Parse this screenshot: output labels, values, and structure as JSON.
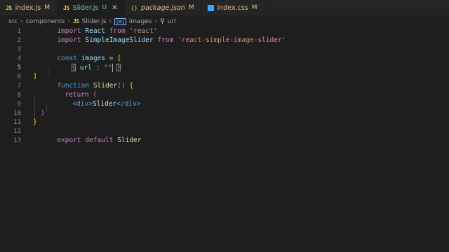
{
  "tabs": [
    {
      "name": "index.js",
      "badge": "M",
      "icon": "js-icon",
      "active": false
    },
    {
      "name": "Slider.js",
      "badge": "U",
      "icon": "js-icon",
      "active": true
    },
    {
      "name": "package.json",
      "badge": "M",
      "icon": "json-icon",
      "active": false
    },
    {
      "name": "index.css",
      "badge": "M",
      "icon": "css-icon",
      "active": false
    }
  ],
  "icons": {
    "js": "JS",
    "json": "{}",
    "close": "✕"
  },
  "breadcrumb": {
    "items": [
      "src",
      "components",
      "Slider.js",
      "images",
      "url"
    ],
    "array_symbol": "[ø]"
  },
  "editor": {
    "line_numbers": [
      "1",
      "2",
      "3",
      "4",
      "5",
      "6",
      "7",
      "8",
      "9",
      "10",
      "11",
      "12",
      "13"
    ],
    "current_line": 5,
    "code": {
      "l1": {
        "import": "import",
        "name": "React",
        "from": "from",
        "module": "'react'"
      },
      "l2": {
        "import": "import",
        "name": "SimpleImageSlider",
        "from": "from",
        "module": "'react-simple-image-slider'"
      },
      "l4": {
        "const": "const",
        "name": "images",
        "eq": "=",
        "open": "["
      },
      "l5": {
        "open": "{",
        "key": "url",
        "colon": ":",
        "value": "\"\"",
        "close": "}"
      },
      "l6": {
        "close": "]"
      },
      "l7": {
        "function": "function",
        "name": "Slider",
        "parens": "()",
        "open": "{"
      },
      "l8": {
        "return": "return",
        "open": "("
      },
      "l9": {
        "open_tag": "<div>",
        "text": "Slider",
        "close_tag": "</div>"
      },
      "l10": {
        "close": ")"
      },
      "l11": {
        "close": "}"
      },
      "l13": {
        "export": "export",
        "default": "default",
        "name": "Slider"
      }
    }
  },
  "colors": {
    "background": "#1e1e1e",
    "tabbar": "#252526",
    "keyword": "#c586c0",
    "string": "#ce9178",
    "bracket_gold": "#ffd700"
  }
}
